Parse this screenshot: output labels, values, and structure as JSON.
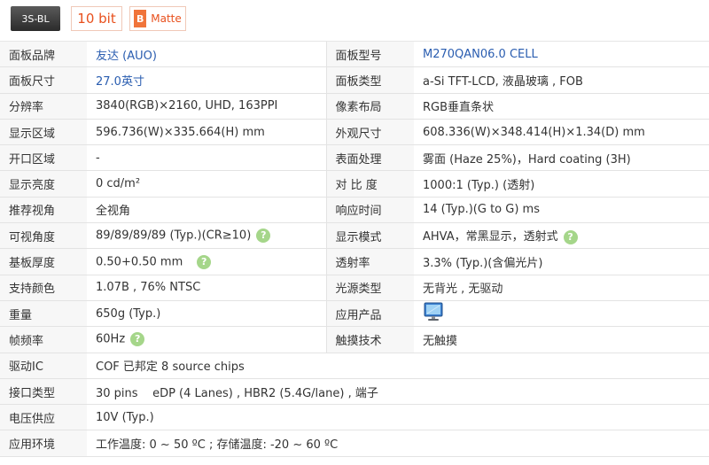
{
  "badges": {
    "backlight": "3S-BL",
    "bit_depth": "10 bit",
    "surface_letter": "B",
    "surface": "Matte"
  },
  "rows": {
    "r1": {
      "k1": "面板品牌",
      "v1": "友达 (AUO)",
      "k2": "面板型号",
      "v2": "M270QAN06.0 CELL"
    },
    "r2": {
      "k1": "面板尺寸",
      "v1": "27.0英寸",
      "k2": "面板类型",
      "v2": "a-Si TFT-LCD, 液晶玻璃 , FOB"
    },
    "r3": {
      "k1": "分辨率",
      "v1": "3840(RGB)×2160, UHD, 163PPI",
      "k2": "像素布局",
      "v2": "RGB垂直条状"
    },
    "r4": {
      "k1": "显示区域",
      "v1": "596.736(W)×335.664(H) mm",
      "k2": "外观尺寸",
      "v2": "608.336(W)×348.414(H)×1.34(D) mm"
    },
    "r5": {
      "k1": "开口区域",
      "v1": "-",
      "k2": "表面处理",
      "v2": "雾面 (Haze 25%)，Hard coating (3H)"
    },
    "r6": {
      "k1": "显示亮度",
      "v1": "0 cd/m²",
      "k2": "对 比 度",
      "v2": "1000:1 (Typ.) (透射)"
    },
    "r7": {
      "k1": "推荐视角",
      "v1": "全视角",
      "k2": "响应时间",
      "v2": "14 (Typ.)(G to G) ms"
    },
    "r8": {
      "k1": "可视角度",
      "v1": "89/89/89/89 (Typ.)(CR≥10)",
      "k2": "显示模式",
      "v2": "AHVA，常黑显示，透射式"
    },
    "r9": {
      "k1": "基板厚度",
      "v1": "0.50+0.50 mm",
      "k2": "透射率",
      "v2": "3.3% (Typ.)(含偏光片)"
    },
    "r10": {
      "k1": "支持颜色",
      "v1": "1.07B , 76% NTSC",
      "k2": "光源类型",
      "v2": "无背光 , 无驱动"
    },
    "r11": {
      "k1": "重量",
      "v1": "650g (Typ.)",
      "k2": "应用产品",
      "v2": ""
    },
    "r12": {
      "k1": "帧频率",
      "v1": "60Hz",
      "k2": "触摸技术",
      "v2": "无触摸"
    },
    "r13": {
      "k1": "驱动IC",
      "v1": "COF 已邦定 8 source chips"
    },
    "r14": {
      "k1": "接口类型",
      "v1": "30 pins    eDP (4 Lanes) , HBR2 (5.4G/lane) , 端子"
    },
    "r15": {
      "k1": "电压供应",
      "v1": "10V (Typ.)"
    },
    "r16": {
      "k1": "应用环境",
      "v1": "工作温度: 0 ~ 50 ºC ; 存储温度: -20 ~ 60 ºC"
    }
  },
  "help_icon_text": "?",
  "icons": {
    "help": "question-circle-icon",
    "product": "monitor-icon"
  },
  "colors": {
    "link": "#2a5db0",
    "help": "#a5d68a",
    "accent": "#e8501d"
  }
}
